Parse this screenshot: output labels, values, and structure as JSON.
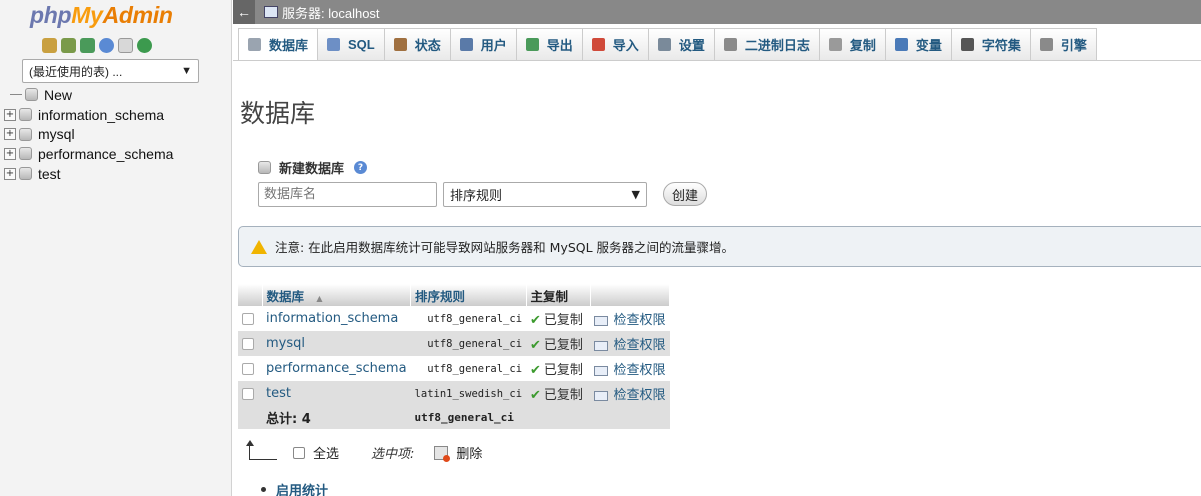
{
  "nav": {
    "logo": {
      "php": "php",
      "my": "My",
      "admin": "Admin"
    },
    "icons": [
      "home-icon",
      "exit-icon",
      "sql-icon",
      "help-icon",
      "docs-icon",
      "reload-icon"
    ],
    "recent_select": "(最近使用的表) ...",
    "tree": [
      {
        "label": "New",
        "type": "new"
      },
      {
        "label": "information_schema",
        "type": "db"
      },
      {
        "label": "mysql",
        "type": "db"
      },
      {
        "label": "performance_schema",
        "type": "db"
      },
      {
        "label": "test",
        "type": "db"
      }
    ]
  },
  "serverbar": {
    "arrow": "←",
    "title": "服务器: localhost"
  },
  "tabs": [
    {
      "label": "数据库",
      "icon": "database-icon",
      "color": "#9aa4b0",
      "active": true
    },
    {
      "label": "SQL",
      "icon": "sql-icon",
      "color": "#6d8fc5"
    },
    {
      "label": "状态",
      "icon": "status-icon",
      "color": "#a07040"
    },
    {
      "label": "用户",
      "icon": "users-icon",
      "color": "#5a7aa8"
    },
    {
      "label": "导出",
      "icon": "export-icon",
      "color": "#4a9a5a"
    },
    {
      "label": "导入",
      "icon": "import-icon",
      "color": "#d04a3a"
    },
    {
      "label": "设置",
      "icon": "settings-icon",
      "color": "#7a8a9a"
    },
    {
      "label": "二进制日志",
      "icon": "binlog-icon",
      "color": "#8a8a8a"
    },
    {
      "label": "复制",
      "icon": "replication-icon",
      "color": "#9a9a9a"
    },
    {
      "label": "变量",
      "icon": "variables-icon",
      "color": "#4a7ab8"
    },
    {
      "label": "字符集",
      "icon": "charset-icon",
      "color": "#555555"
    },
    {
      "label": "引擎",
      "icon": "engine-icon",
      "color": "#8a8a8a"
    }
  ],
  "main": {
    "title": "数据库",
    "create": {
      "title": "新建数据库",
      "name_placeholder": "数据库名",
      "collation_selected": "排序规则",
      "button": "创建"
    },
    "notice": "注意: 在此启用数据库统计可能导致网站服务器和 MySQL 服务器之间的流量骤增。",
    "table": {
      "headers": {
        "database": "数据库",
        "sort_arrow": "▲",
        "collation": "排序规则",
        "replication": "主复制"
      },
      "rows": [
        {
          "name": "information_schema",
          "collation": "utf8_general_ci",
          "replication": "已复制",
          "privileges": "检查权限"
        },
        {
          "name": "mysql",
          "collation": "utf8_general_ci",
          "replication": "已复制",
          "privileges": "检查权限"
        },
        {
          "name": "performance_schema",
          "collation": "utf8_general_ci",
          "replication": "已复制",
          "privileges": "检查权限"
        },
        {
          "name": "test",
          "collation": "latin1_swedish_ci",
          "replication": "已复制",
          "privileges": "检查权限"
        }
      ],
      "total_label": "总计: 4",
      "total_collation": "utf8_general_ci"
    },
    "bulk": {
      "select_all": "全选",
      "with_selected": "选中项:",
      "delete": "删除"
    },
    "enable_stats": "启用统计"
  }
}
